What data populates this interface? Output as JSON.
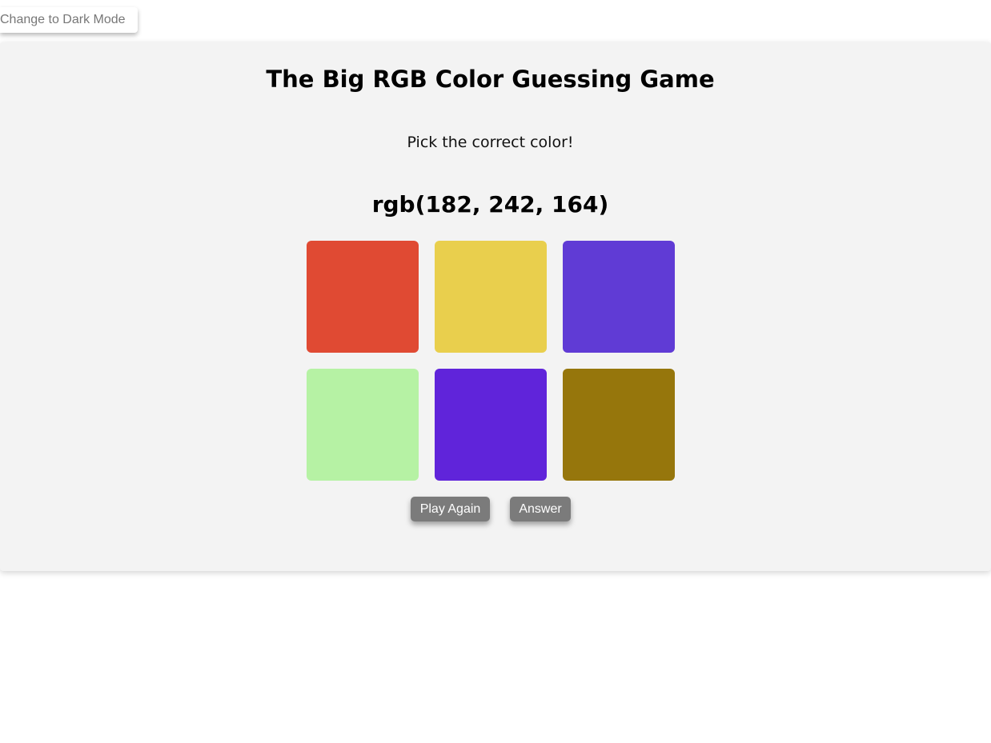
{
  "controls": {
    "dark_mode_label": "Change to Dark Mode"
  },
  "game": {
    "title": "The Big RGB Color Guessing Game",
    "instruction": "Pick the correct color!",
    "target_rgb": "rgb(182, 242, 164)",
    "swatches": [
      {
        "color": "#e04a33"
      },
      {
        "color": "#e9cf4d"
      },
      {
        "color": "#603bd5"
      },
      {
        "color": "#b6f2a4"
      },
      {
        "color": "#6024da"
      },
      {
        "color": "#96760c"
      }
    ],
    "play_again_label": "Play Again",
    "answer_label": "Answer"
  },
  "colors": {
    "card_background": "#f3f3f3",
    "button_gray": "#7b7b7b",
    "mode_text": "#777777"
  }
}
